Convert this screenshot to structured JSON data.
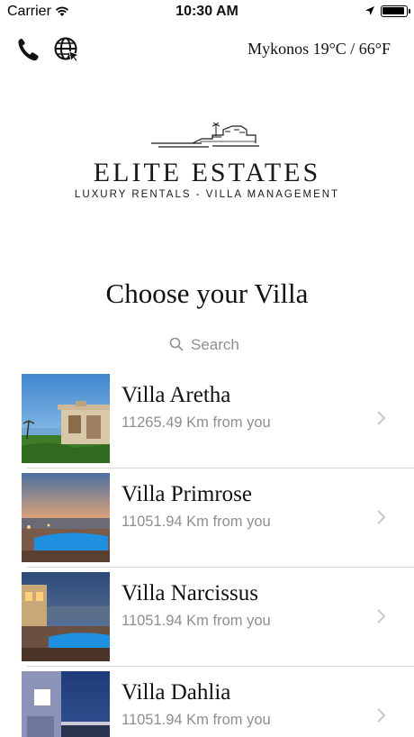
{
  "status_bar": {
    "carrier": "Carrier",
    "time": "10:30 AM"
  },
  "top_bar": {
    "weather": "Mykonos 19°C / 66°F",
    "icons": [
      "phone-icon",
      "globe-icon"
    ]
  },
  "logo": {
    "title": "ELITE ESTATES",
    "subtitle": "LUXURY RENTALS - VILLA MANAGEMENT"
  },
  "main": {
    "title": "Choose your Villa",
    "search": {
      "placeholder": "Search",
      "value": ""
    }
  },
  "villas": [
    {
      "name": "Villa Aretha",
      "distance": "11265.49 Km from you"
    },
    {
      "name": "Villa Primrose",
      "distance": "11051.94 Km from you"
    },
    {
      "name": "Villa Narcissus",
      "distance": "11051.94 Km from you"
    },
    {
      "name": "Villa Dahlia",
      "distance": "11051.94 Km from you"
    }
  ],
  "colors": {
    "secondary_text": "#8e8e93",
    "divider": "#d9d9d9",
    "pool_blue": "#1f8fe0"
  }
}
